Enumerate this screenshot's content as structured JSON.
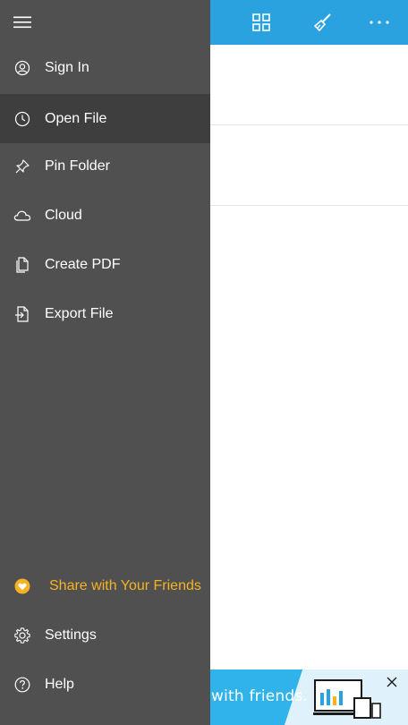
{
  "app": {
    "accent": "#2aa2e0",
    "toolbar_actions": [
      {
        "name": "grid-view",
        "icon": "grid-icon"
      },
      {
        "name": "format",
        "icon": "brush-icon"
      },
      {
        "name": "more",
        "icon": "more-icon"
      }
    ]
  },
  "drawer": {
    "menu_icon": "hamburger-icon",
    "items": [
      {
        "label": "Sign In",
        "icon": "user-icon",
        "active": false
      },
      {
        "label": "Open File",
        "icon": "clock-icon",
        "active": true
      },
      {
        "label": "Pin Folder",
        "icon": "pin-icon",
        "active": false
      },
      {
        "label": "Cloud",
        "icon": "cloud-icon",
        "active": false
      },
      {
        "label": "Create PDF",
        "icon": "pdf-icon",
        "active": false
      },
      {
        "label": "Export File",
        "icon": "export-icon",
        "active": false
      }
    ],
    "bottom_items": [
      {
        "label": "Share with Your Friends",
        "icon": "heart-icon",
        "color": "#f5b324"
      },
      {
        "label": "Settings",
        "icon": "gear-icon"
      },
      {
        "label": "Help",
        "icon": "help-icon"
      }
    ]
  },
  "banner": {
    "text": "with friends.",
    "close_icon": "close-icon"
  }
}
